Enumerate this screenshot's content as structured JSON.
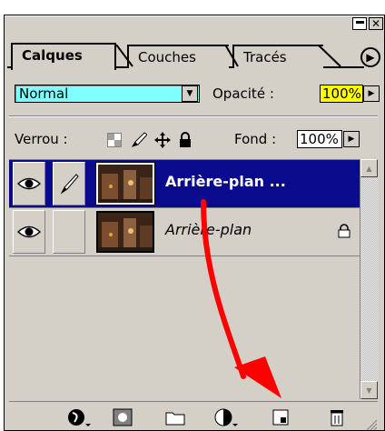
{
  "tabs": [
    {
      "label": "Calques",
      "active": true
    },
    {
      "label": "Couches",
      "active": false
    },
    {
      "label": "Tracés",
      "active": false
    }
  ],
  "blend": {
    "mode": "Normal",
    "opacity_label": "Opacité :",
    "opacity_value": "100%"
  },
  "lock": {
    "label": "Verrou :",
    "fill_label": "Fond :",
    "fill_value": "100%"
  },
  "layers": [
    {
      "name": "Arrière-plan ...",
      "selected": true,
      "visible": true,
      "locked": false
    },
    {
      "name": "Arrière-plan",
      "selected": false,
      "visible": true,
      "locked": true
    }
  ],
  "toolbar_icons": [
    "layer-style-icon",
    "mask-icon",
    "new-set-icon",
    "adjustment-layer-icon",
    "new-layer-icon",
    "trash-icon"
  ],
  "colors": {
    "panel": "#d4d0c8",
    "selection": "#0a0a8c",
    "blend_field": "#80ffff",
    "opacity_field": "#ffff00",
    "annotation_arrow": "#ff0000"
  }
}
